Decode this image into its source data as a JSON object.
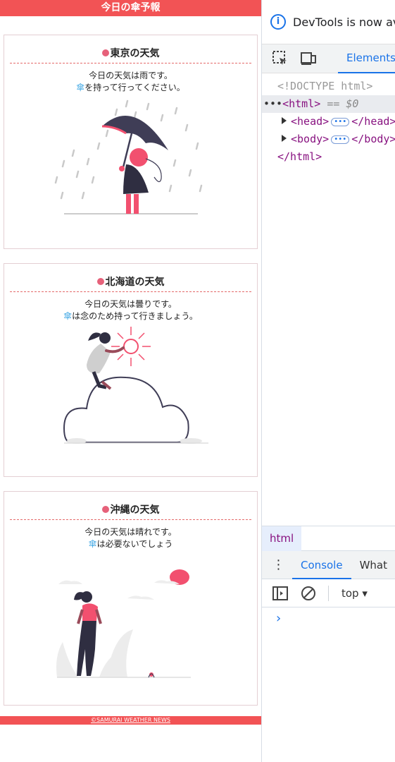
{
  "site": {
    "title": "今日の傘予報",
    "footer": "©SAMURAI WEATHER NEWS"
  },
  "cards": [
    {
      "title": "東京の天気",
      "line1": "今日の天気は雨です。",
      "umbrella_glyph": "傘",
      "line2": "を持って行ってください。"
    },
    {
      "title": "北海道の天気",
      "line1": "今日の天気は曇りです。",
      "umbrella_glyph": "傘",
      "line2": "は念のため持って行きましょう。"
    },
    {
      "title": "沖縄の天気",
      "line1": "今日の天気は晴れです。",
      "umbrella_glyph": "傘",
      "line2": "は必要ないでしょう"
    }
  ],
  "devtools": {
    "banner": "DevTools is now av",
    "tab_elements": "Elements",
    "dom": {
      "doctype": "<!DOCTYPE html>",
      "html_open": "<html>",
      "selected_marker": "== $0",
      "head_open": "<head>",
      "head_close": "</head>",
      "body_open": "<body>",
      "body_close": "</body>",
      "html_close": "</html>"
    },
    "breadcrumb": "html",
    "tab_console": "Console",
    "tab_whats": "What",
    "context": "top",
    "prompt": "›"
  },
  "colors": {
    "header_bg": "#f25355",
    "accent_pink": "#f2506f",
    "umbrella_blue": "#3fa7e4",
    "devtools_blue": "#1a73e8"
  }
}
